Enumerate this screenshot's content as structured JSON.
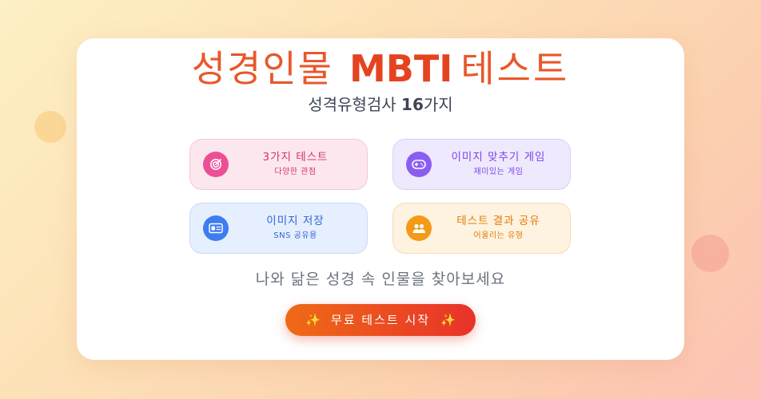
{
  "header": {
    "title_part1": "성경인물",
    "title_part2": "MBTI",
    "title_part3": "테스트",
    "subtitle_prefix": "성격유형검사 ",
    "subtitle_count": "16",
    "subtitle_suffix": "가지"
  },
  "features": [
    {
      "title": "3가지 테스트",
      "subtitle": "다양한 관점",
      "icon": "target-icon",
      "color": "#ec4f95"
    },
    {
      "title": "이미지 맞추기 게임",
      "subtitle": "재미있는 게임",
      "icon": "gamepad-icon",
      "color": "#8b5ef2"
    },
    {
      "title": "이미지 저장",
      "subtitle": "SNS 공유용",
      "icon": "id-card-icon",
      "color": "#3d7df0"
    },
    {
      "title": "테스트 결과 공유",
      "subtitle": "어울리는 유형",
      "icon": "users-icon",
      "color": "#f39a16"
    }
  ],
  "tagline": "나와 닮은 성경 속 인물을 찾아보세요",
  "cta": {
    "label": "무료 테스트 시작",
    "spark_left": "✨",
    "spark_right": "✨"
  },
  "colors": {
    "accent": "#e8582a",
    "cta_start": "#ef6a16",
    "cta_end": "#e8322a"
  }
}
